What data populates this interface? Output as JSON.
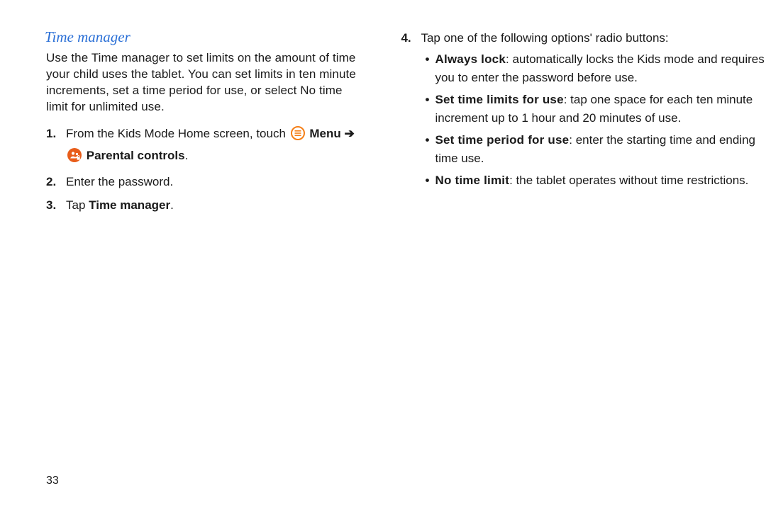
{
  "heading": "Time manager",
  "intro": "Use the Time manager to set limits on the amount of time your child uses the tablet. You can set limits in ten minute increments, set a time period for use, or select No time limit for unlimited use.",
  "steps": {
    "s1": {
      "n": "1.",
      "pre": "From the Kids Mode Home screen, touch ",
      "menu": "Menu",
      "arrow": "➔",
      "pc": "Parental controls",
      "dot": "."
    },
    "s2": {
      "n": "2.",
      "text": "Enter the password."
    },
    "s3": {
      "n": "3.",
      "pre": "Tap ",
      "bold": "Time manager",
      "dot": "."
    },
    "s4": {
      "n": "4.",
      "text": "Tap one of the following options' radio buttons:"
    }
  },
  "options": {
    "o1": {
      "label": "Always lock",
      "text": ": automatically locks the Kids mode and requires you to enter the password before use."
    },
    "o2": {
      "label": "Set time limits for use",
      "text": ": tap one space for each ten minute increment up to 1 hour and 20 minutes of use."
    },
    "o3": {
      "label": "Set time period for use",
      "text": ": enter the starting time and ending time use."
    },
    "o4": {
      "label": "No time limit",
      "text": ": the tablet operates without time restrictions."
    }
  },
  "pageNumber": "33"
}
